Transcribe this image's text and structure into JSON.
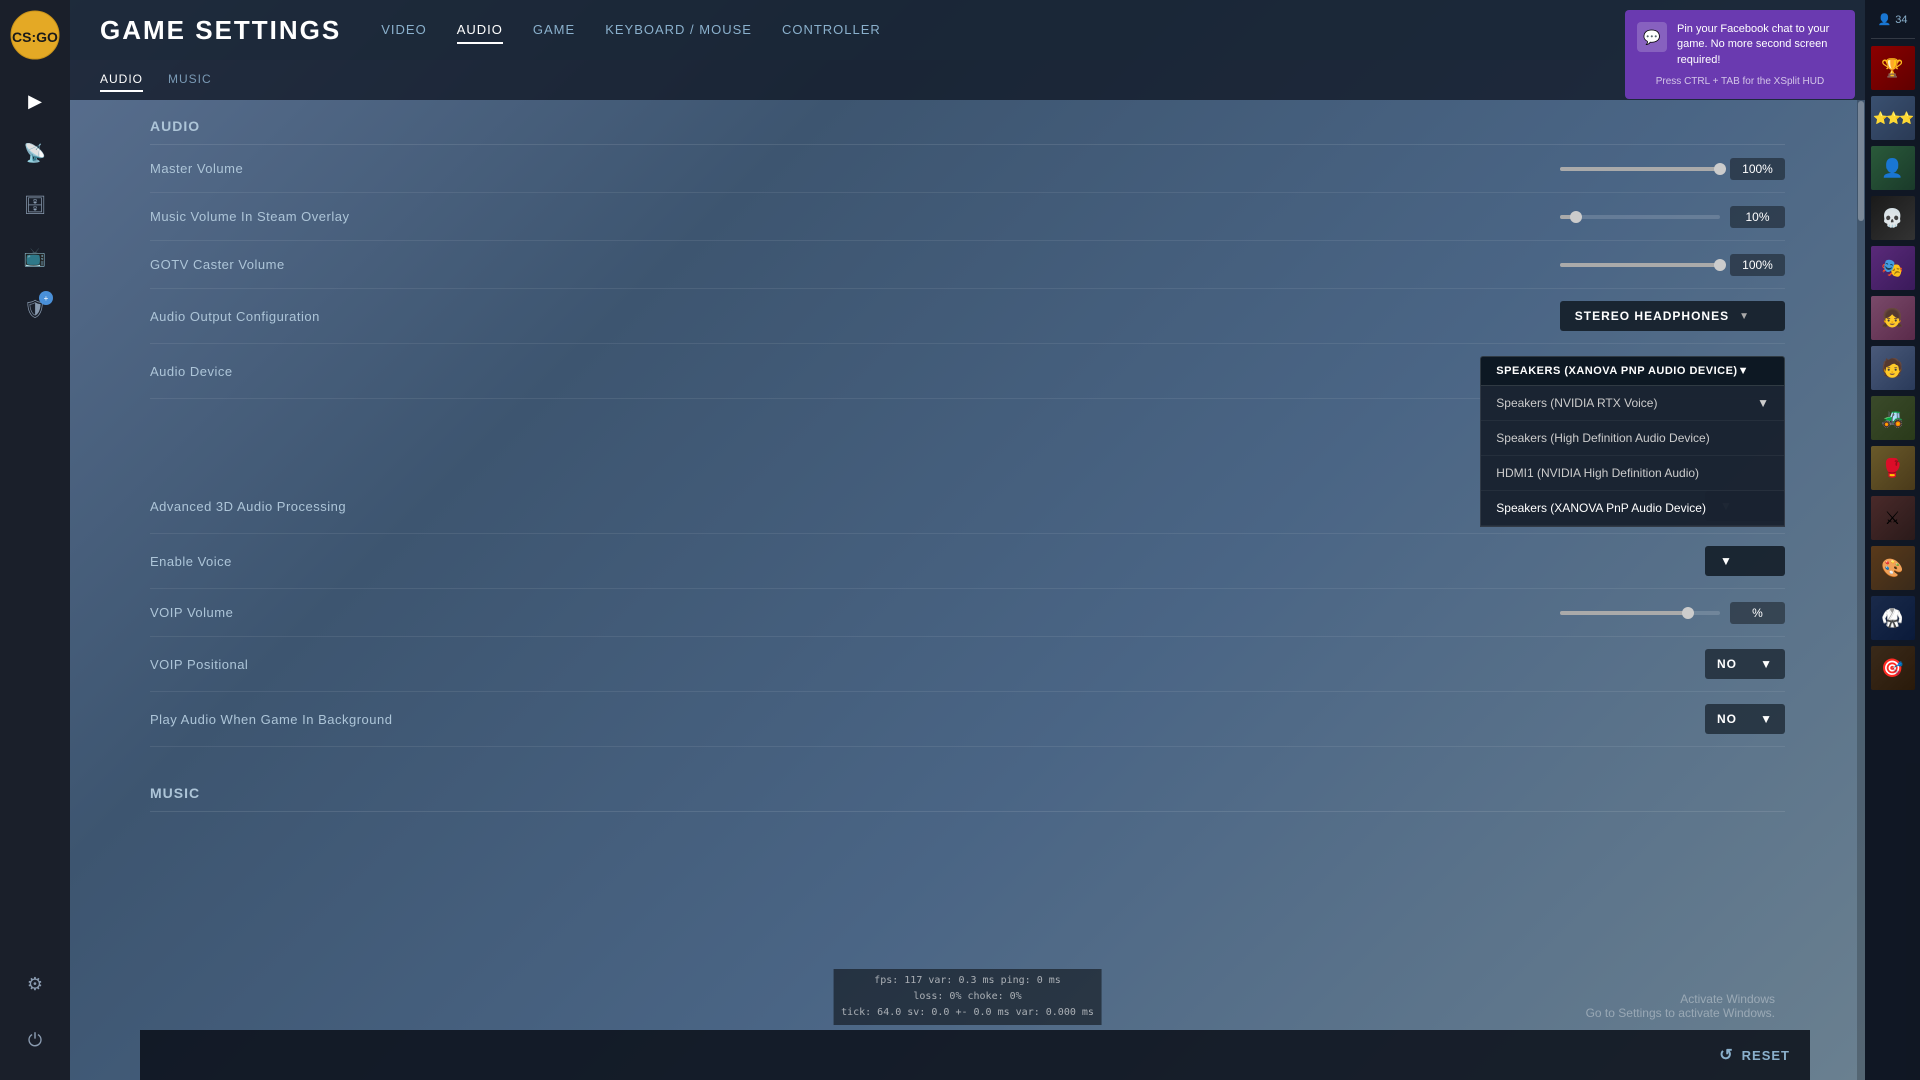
{
  "app": {
    "title": "GAME SETTINGS"
  },
  "sidebar": {
    "icons": [
      {
        "name": "play-icon",
        "symbol": "▶",
        "active": true
      },
      {
        "name": "antenna-icon",
        "symbol": "📡",
        "active": false
      },
      {
        "name": "briefcase-icon",
        "symbol": "🗄",
        "active": false
      },
      {
        "name": "tv-icon",
        "symbol": "📺",
        "active": false
      },
      {
        "name": "shield-plus-icon",
        "symbol": "🛡",
        "active": false,
        "badge": "+"
      },
      {
        "name": "gear-icon",
        "symbol": "⚙",
        "active": false
      }
    ],
    "power_icon": "⏻"
  },
  "nav": {
    "tabs": [
      {
        "label": "Video",
        "active": false
      },
      {
        "label": "Audio",
        "active": true
      },
      {
        "label": "Game",
        "active": false
      },
      {
        "label": "Keyboard / Mouse",
        "active": false
      },
      {
        "label": "Controller",
        "active": false
      }
    ],
    "sub_tabs": [
      {
        "label": "Audio",
        "active": true
      },
      {
        "label": "Music",
        "active": false
      }
    ]
  },
  "audio_section": {
    "title": "Audio",
    "settings": [
      {
        "label": "Master Volume",
        "type": "slider",
        "value": "100%",
        "fill_percent": 100
      },
      {
        "label": "Music Volume In Steam Overlay",
        "type": "slider",
        "value": "10%",
        "fill_percent": 10
      },
      {
        "label": "GOTV Caster Volume",
        "type": "slider",
        "value": "100%",
        "fill_percent": 100
      },
      {
        "label": "Audio Output Configuration",
        "type": "dropdown",
        "value": "STEREO HEADPHONES"
      },
      {
        "label": "Audio Device",
        "type": "dropdown_open",
        "value": "SPEAKERS (XANOVA PNP AUDIO DEVICE)"
      },
      {
        "label": "Advanced 3D Audio Processing",
        "type": "toggle"
      },
      {
        "label": "Enable Voice",
        "type": "toggle"
      },
      {
        "label": "VOIP Volume",
        "type": "slider_value",
        "value": "%"
      },
      {
        "label": "VOIP Positional",
        "type": "dropdown",
        "value": "NO"
      },
      {
        "label": "Play Audio When Game In Background",
        "type": "dropdown",
        "value": "NO"
      }
    ],
    "audio_device_options": [
      {
        "label": "Speakers (NVIDIA RTX Voice)",
        "has_arrow": true
      },
      {
        "label": "Speakers (High Definition Audio Device)",
        "has_arrow": false
      },
      {
        "label": "HDMI1 (NVIDIA High Definition Audio)",
        "has_arrow": false
      },
      {
        "label": "Speakers (XANOVA PnP Audio Device)",
        "has_arrow": false,
        "selected": true
      }
    ]
  },
  "music_section": {
    "title": "Music"
  },
  "notification": {
    "icon": "💬",
    "text": "Pin your Facebook chat to your game. No more second screen required!",
    "hint": "Press CTRL + TAB for the XSplit HUD"
  },
  "right_panel": {
    "player_count": "34",
    "player_icon": "👤"
  },
  "debug": {
    "line1": "fps:  117  var: 0.3 ms  ping: 0 ms",
    "line2": "loss:  0%  choke:  0%",
    "line3": "tick: 64.0  sv: 0.0 +- 0.0 ms  var: 0.000 ms"
  },
  "watermark": {
    "line1": "Activate Windows",
    "line2": "Go to Settings to activate Windows."
  },
  "bottom": {
    "reset_label": "RESET",
    "reset_icon": "↺"
  }
}
